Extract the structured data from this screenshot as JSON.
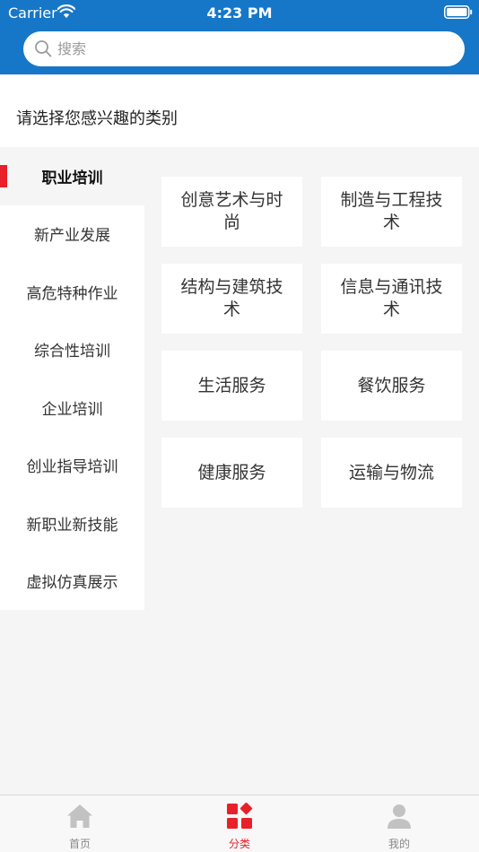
{
  "status_bar": {
    "carrier": "Carrier",
    "time": "4:23 PM"
  },
  "search": {
    "placeholder": "搜索"
  },
  "prompt": "请选择您感兴趣的类别",
  "sidebar": {
    "items": [
      {
        "label": "职业培训",
        "active": true
      },
      {
        "label": "新产业发展"
      },
      {
        "label": "高危特种作业"
      },
      {
        "label": "综合性培训"
      },
      {
        "label": "企业培训"
      },
      {
        "label": "创业指导培训"
      },
      {
        "label": "新职业新技能"
      },
      {
        "label": "虚拟仿真展示"
      }
    ]
  },
  "categories": [
    {
      "label": "创意艺术与时尚"
    },
    {
      "label": "制造与工程技术"
    },
    {
      "label": "结构与建筑技术"
    },
    {
      "label": "信息与通讯技术"
    },
    {
      "label": "生活服务"
    },
    {
      "label": "餐饮服务"
    },
    {
      "label": "健康服务"
    },
    {
      "label": "运输与物流"
    }
  ],
  "tabbar": {
    "home": {
      "label": "首页",
      "icon": "home-icon"
    },
    "category": {
      "label": "分类",
      "icon": "category-icon",
      "active": true
    },
    "mine": {
      "label": "我的",
      "icon": "user-icon"
    }
  },
  "colors": {
    "primary": "#1677c8",
    "accent": "#e8202a",
    "background": "#f5f5f5",
    "tab_inactive": "#c2c2c2"
  }
}
